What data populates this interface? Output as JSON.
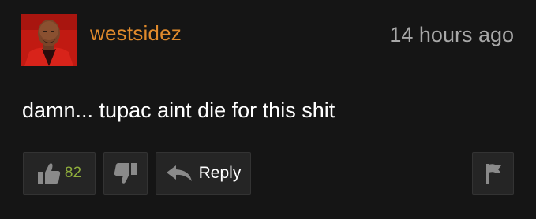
{
  "comment": {
    "username": "westsidez",
    "timestamp": "14 hours ago",
    "text": "damn... tupac aint die for this shit",
    "likes": "82",
    "reply_label": "Reply"
  },
  "icons": {
    "like": "thumbs-up-icon",
    "dislike": "thumbs-down-icon",
    "reply": "reply-arrow-icon",
    "flag": "flag-icon"
  },
  "colors": {
    "username": "#e08a2c",
    "likes": "#8fae3c",
    "background": "#151515"
  }
}
